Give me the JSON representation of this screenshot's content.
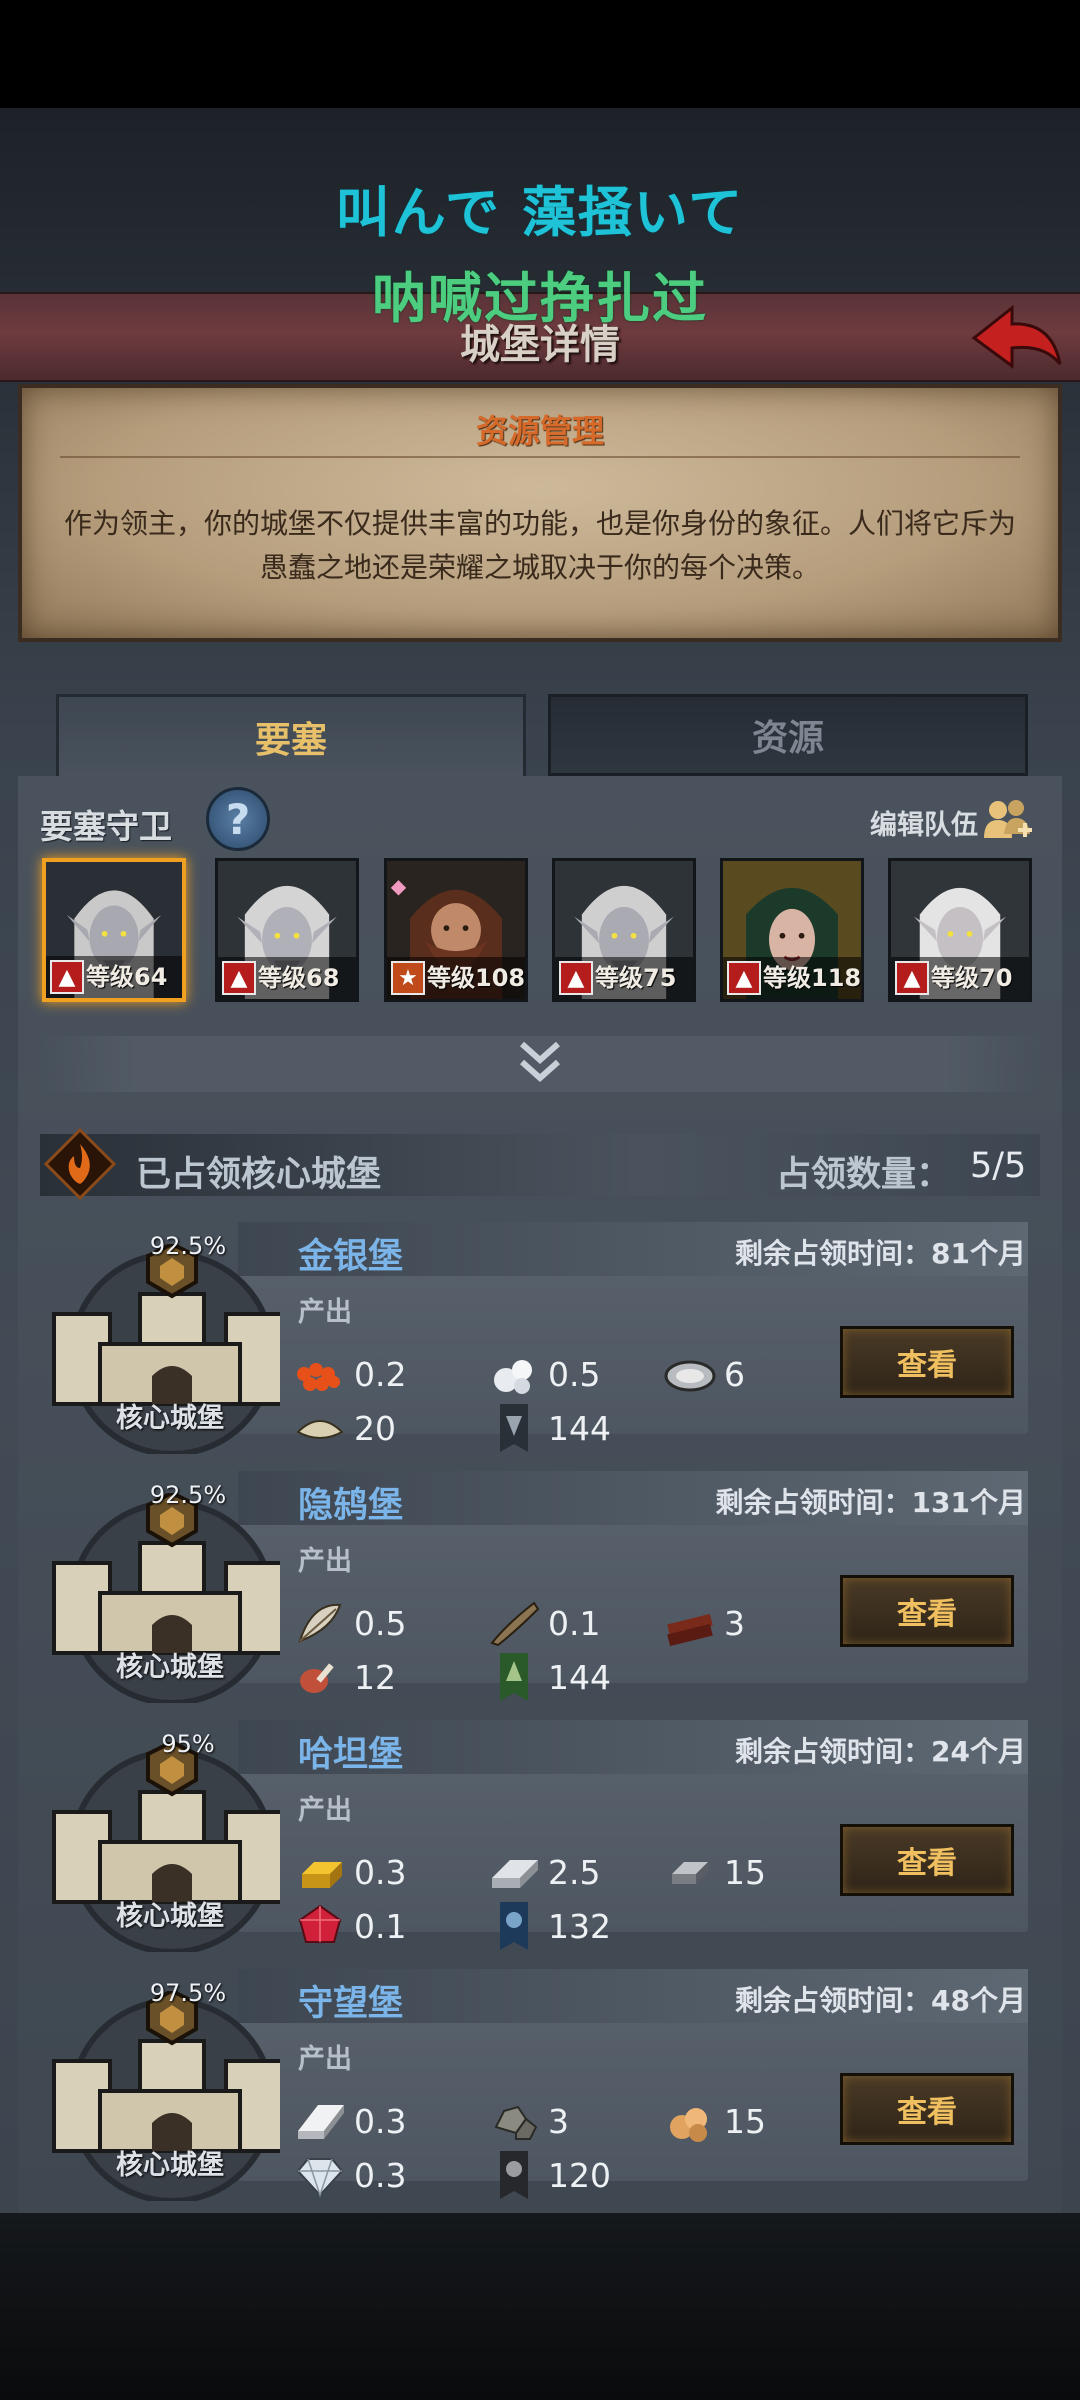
{
  "lyrics": {
    "line1": "叫んで 藻掻いて",
    "line2": "呐喊过挣扎过"
  },
  "header": {
    "title": "城堡详情",
    "back_icon": "back-arrow-icon"
  },
  "info": {
    "title": "资源管理",
    "description": "作为领主，你的城堡不仅提供丰富的功能，也是你身份的象征。人们将它斥为愚蠢之地还是荣耀之城取决于你的每个决策。"
  },
  "tabs": [
    {
      "label": "要塞",
      "active": true
    },
    {
      "label": "资源",
      "active": false
    }
  ],
  "guards": {
    "title": "要塞守卫",
    "edit_label": "编辑队伍",
    "heroes": [
      {
        "level": "等级64",
        "selected": true
      },
      {
        "level": "等级68",
        "selected": false
      },
      {
        "level": "等级108",
        "selected": false
      },
      {
        "level": "等级75",
        "selected": false
      },
      {
        "level": "等级118",
        "selected": false
      },
      {
        "level": "等级70",
        "selected": false
      }
    ]
  },
  "occupied": {
    "title": "已占领核心城堡",
    "count_label": "占领数量：",
    "count": "5/5"
  },
  "castles": [
    {
      "name": "金银堡",
      "percent": "92.5%",
      "type": "核心城堡",
      "time_label": "剩余占领时间：",
      "time_value": "81个月",
      "output_label": "产出",
      "button": "查看",
      "resources": [
        {
          "icon": "caviar-icon",
          "value": "0.2"
        },
        {
          "icon": "pearl-icon",
          "value": "0.5"
        },
        {
          "icon": "oyster-icon",
          "value": "6"
        },
        {
          "icon": "shell-icon",
          "value": "20"
        },
        {
          "icon": "banner-icon",
          "value": "144"
        }
      ]
    },
    {
      "name": "隐鸫堡",
      "percent": "92.5%",
      "type": "核心城堡",
      "time_label": "剩余占领时间：",
      "time_value": "131个月",
      "output_label": "产出",
      "button": "查看",
      "resources": [
        {
          "icon": "feather-icon",
          "value": "0.5"
        },
        {
          "icon": "horn-icon",
          "value": "0.1"
        },
        {
          "icon": "wood-icon",
          "value": "3"
        },
        {
          "icon": "meat-icon",
          "value": "12"
        },
        {
          "icon": "banner-icon",
          "value": "144"
        }
      ]
    },
    {
      "name": "哈坦堡",
      "percent": "95%",
      "type": "核心城堡",
      "time_label": "剩余占领时间：",
      "time_value": "24个月",
      "output_label": "产出",
      "button": "查看",
      "resources": [
        {
          "icon": "gold-bar-icon",
          "value": "0.3"
        },
        {
          "icon": "silver-bar-icon",
          "value": "2.5"
        },
        {
          "icon": "iron-bar-icon",
          "value": "15"
        },
        {
          "icon": "ruby-icon",
          "value": "0.1"
        },
        {
          "icon": "banner-icon",
          "value": "132"
        }
      ]
    },
    {
      "name": "守望堡",
      "percent": "97.5%",
      "type": "核心城堡",
      "time_label": "剩余占领时间：",
      "time_value": "48个月",
      "output_label": "产出",
      "button": "查看",
      "resources": [
        {
          "icon": "steel-bar-icon",
          "value": "0.3"
        },
        {
          "icon": "stone-icon",
          "value": "3"
        },
        {
          "icon": "ore-icon",
          "value": "15"
        },
        {
          "icon": "diamond-icon",
          "value": "0.3"
        },
        {
          "icon": "banner-icon",
          "value": "120"
        }
      ]
    }
  ]
}
